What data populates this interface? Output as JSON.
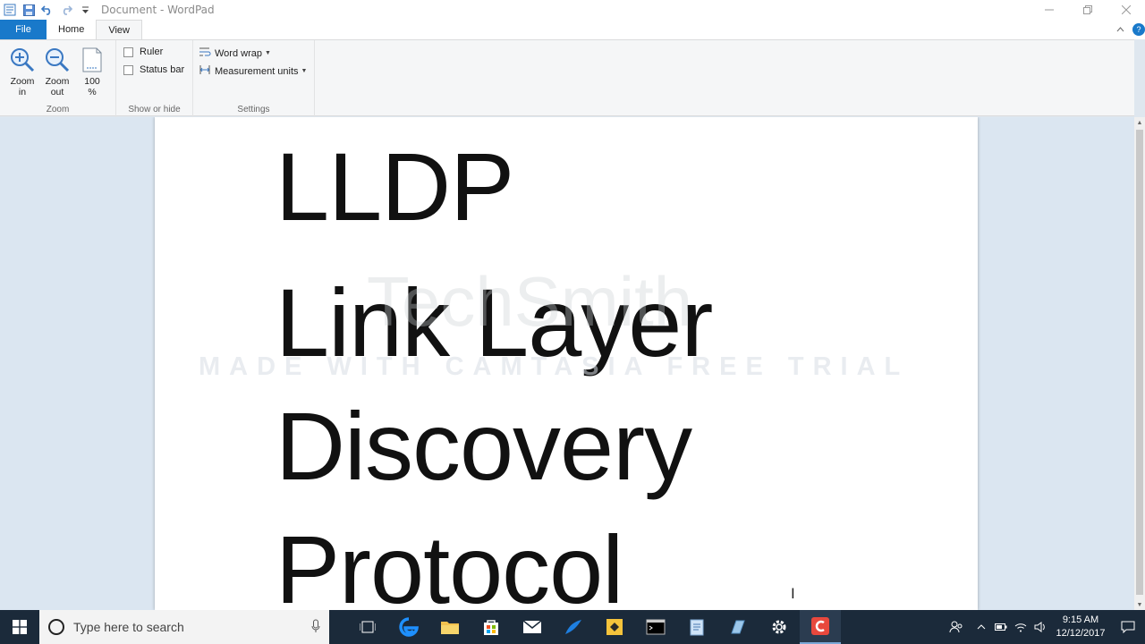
{
  "window": {
    "title": "Document - WordPad"
  },
  "tabs": {
    "file": "File",
    "home": "Home",
    "view": "View"
  },
  "ribbon": {
    "zoom": {
      "zoom_in": [
        "Zoom",
        "in"
      ],
      "zoom_out": [
        "Zoom",
        "out"
      ],
      "hundred": [
        "100",
        "%"
      ],
      "label": "Zoom"
    },
    "show_hide": {
      "ruler": "Ruler",
      "ruler_checked": false,
      "status_bar": "Status bar",
      "status_bar_checked": false,
      "label": "Show or hide"
    },
    "settings": {
      "word_wrap": "Word wrap",
      "measurement_units": "Measurement units",
      "label": "Settings"
    }
  },
  "document": {
    "lines": [
      "LLDP",
      "Link Layer",
      "Discovery",
      "Protocol"
    ]
  },
  "watermark": {
    "logo": "TechSmith",
    "text": "MADE WITH CAMTASIA FREE TRIAL"
  },
  "taskbar": {
    "search_placeholder": "Type here to search",
    "clock_time": "9:15 AM",
    "clock_date": "12/12/2017",
    "apps": [
      "task-view-icon",
      "edge-icon",
      "file-explorer-icon",
      "store-icon",
      "mail-icon",
      "app-icon",
      "files-icon",
      "terminal-icon",
      "notepad-icon",
      "app2-icon",
      "settings-icon",
      "camtasia-icon"
    ]
  },
  "colors": {
    "file_tab": "#1979ca",
    "taskbar": "#1b2a3a",
    "doc_background": "#dbe6f1"
  }
}
